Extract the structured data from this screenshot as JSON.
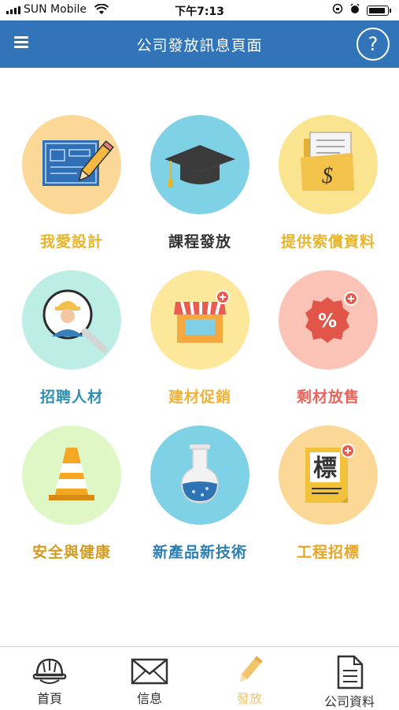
{
  "status": {
    "carrier": "SUN Mobile",
    "time": "下午7:13"
  },
  "header": {
    "title": "公司發放訊息頁面",
    "help": "?"
  },
  "tiles": [
    {
      "label": "我愛設計",
      "bg": "#fcd896",
      "label_color": "#e8b429",
      "icon": "blueprint-icon"
    },
    {
      "label": "課程發放",
      "bg": "#7fd1e6",
      "label_color": "#333333",
      "icon": "graduation-cap-icon"
    },
    {
      "label": "提供索償資料",
      "bg": "#fbe48f",
      "label_color": "#e8b429",
      "icon": "folder-money-icon"
    },
    {
      "label": "招聘人材",
      "bg": "#bdeee6",
      "label_color": "#2f8fb0",
      "icon": "worker-search-icon"
    },
    {
      "label": "建材促銷",
      "bg": "#fde79a",
      "label_color": "#f0b237",
      "icon": "store-icon"
    },
    {
      "label": "剩材放售",
      "bg": "#fbc3b6",
      "label_color": "#e8645a",
      "icon": "discount-badge-icon"
    },
    {
      "label": "安全與健康",
      "bg": "#dff7c4",
      "label_color": "#d49b1f",
      "icon": "traffic-cone-icon"
    },
    {
      "label": "新產品新技術",
      "bg": "#7fd1e6",
      "label_color": "#2c7fb0",
      "icon": "flask-icon"
    },
    {
      "label": "工程招標",
      "bg": "#fcd896",
      "label_color": "#e8a425",
      "icon": "tender-document-icon"
    }
  ],
  "tender_char": "標",
  "discount_char": "%",
  "money_char": "$",
  "tabs": [
    {
      "label": "首頁",
      "icon": "helmet-icon",
      "active": false
    },
    {
      "label": "信息",
      "icon": "envelope-icon",
      "active": false
    },
    {
      "label": "發放",
      "icon": "pencil-icon",
      "active": true
    },
    {
      "label": "公司資料",
      "icon": "document-icon",
      "active": false
    }
  ],
  "colors": {
    "nav": "#3274b8",
    "active_tab": "#f3c56a"
  }
}
